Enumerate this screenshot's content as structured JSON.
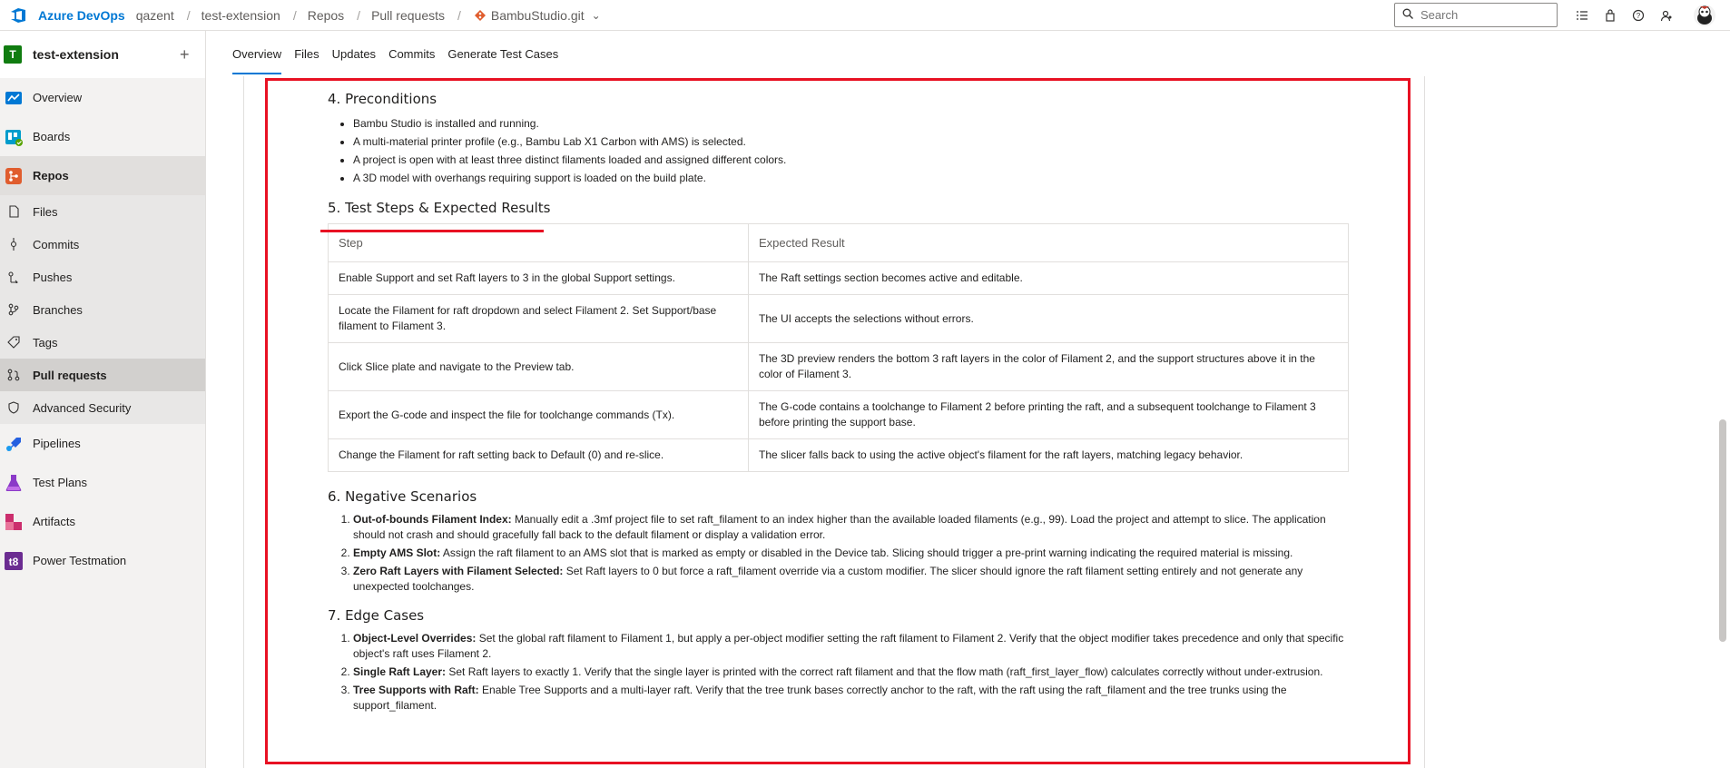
{
  "header": {
    "brand": "Azure DevOps",
    "breadcrumbs": [
      "qazent",
      "test-extension",
      "Repos",
      "Pull requests"
    ],
    "repo": "BambuStudio.git",
    "search_placeholder": "Search"
  },
  "sidebar": {
    "project": "test-extension",
    "items": [
      {
        "label": "Overview"
      },
      {
        "label": "Boards"
      },
      {
        "label": "Repos"
      },
      {
        "label": "Files"
      },
      {
        "label": "Commits"
      },
      {
        "label": "Pushes"
      },
      {
        "label": "Branches"
      },
      {
        "label": "Tags"
      },
      {
        "label": "Pull requests"
      },
      {
        "label": "Advanced Security"
      },
      {
        "label": "Pipelines"
      },
      {
        "label": "Test Plans"
      },
      {
        "label": "Artifacts"
      },
      {
        "label": "Power Testmation"
      }
    ]
  },
  "tabs": [
    "Overview",
    "Files",
    "Updates",
    "Commits",
    "Generate Test Cases"
  ],
  "doc": {
    "preconditions": {
      "title": "4. Preconditions",
      "items": [
        "Bambu Studio is installed and running.",
        "A multi-material printer profile (e.g., Bambu Lab X1 Carbon with AMS) is selected.",
        "A project is open with at least three distinct filaments loaded and assigned different colors.",
        "A 3D model with overhangs requiring support is loaded on the build plate."
      ]
    },
    "steps": {
      "title": "5. Test Steps & Expected Results",
      "col_step": "Step",
      "col_expected": "Expected Result",
      "rows": [
        {
          "step": "Enable Support and set Raft layers to 3 in the global Support settings.",
          "expected": "The Raft settings section becomes active and editable."
        },
        {
          "step": "Locate the Filament for raft dropdown and select Filament 2. Set Support/base filament to Filament 3.",
          "expected": "The UI accepts the selections without errors."
        },
        {
          "step": "Click Slice plate and navigate to the Preview tab.",
          "expected": "The 3D preview renders the bottom 3 raft layers in the color of Filament 2, and the support structures above it in the color of Filament 3."
        },
        {
          "step": "Export the G-code and inspect the file for toolchange commands (Tx).",
          "expected": "The G-code contains a toolchange to Filament 2 before printing the raft, and a subsequent toolchange to Filament 3 before printing the support base."
        },
        {
          "step": "Change the Filament for raft setting back to Default (0) and re-slice.",
          "expected": "The slicer falls back to using the active object's filament for the raft layers, matching legacy behavior."
        }
      ]
    },
    "negative": {
      "title": "6. Negative Scenarios",
      "items": [
        {
          "bold": "Out-of-bounds Filament Index:",
          "text": " Manually edit a .3mf project file to set raft_filament to an index higher than the available loaded filaments (e.g., 99). Load the project and attempt to slice. The application should not crash and should gracefully fall back to the default filament or display a validation error."
        },
        {
          "bold": "Empty AMS Slot:",
          "text": " Assign the raft filament to an AMS slot that is marked as empty or disabled in the Device tab. Slicing should trigger a pre-print warning indicating the required material is missing."
        },
        {
          "bold": "Zero Raft Layers with Filament Selected:",
          "text": " Set Raft layers to 0 but force a raft_filament override via a custom modifier. The slicer should ignore the raft filament setting entirely and not generate any unexpected toolchanges."
        }
      ]
    },
    "edge": {
      "title": "7. Edge Cases",
      "items": [
        {
          "bold": "Object-Level Overrides:",
          "text": " Set the global raft filament to Filament 1, but apply a per-object modifier setting the raft filament to Filament 2. Verify that the object modifier takes precedence and only that specific object's raft uses Filament 2."
        },
        {
          "bold": "Single Raft Layer:",
          "text": " Set Raft layers to exactly 1. Verify that the single layer is printed with the correct raft filament and that the flow math (raft_first_layer_flow) calculates correctly without under-extrusion."
        },
        {
          "bold": "Tree Supports with Raft:",
          "text": " Enable Tree Supports and a multi-layer raft. Verify that the tree trunk bases correctly anchor to the raft, with the raft using the raft_filament and the tree trunks using the support_filament."
        }
      ]
    }
  },
  "colors": {
    "accent": "#0078d4",
    "highlight": "#e81123"
  }
}
